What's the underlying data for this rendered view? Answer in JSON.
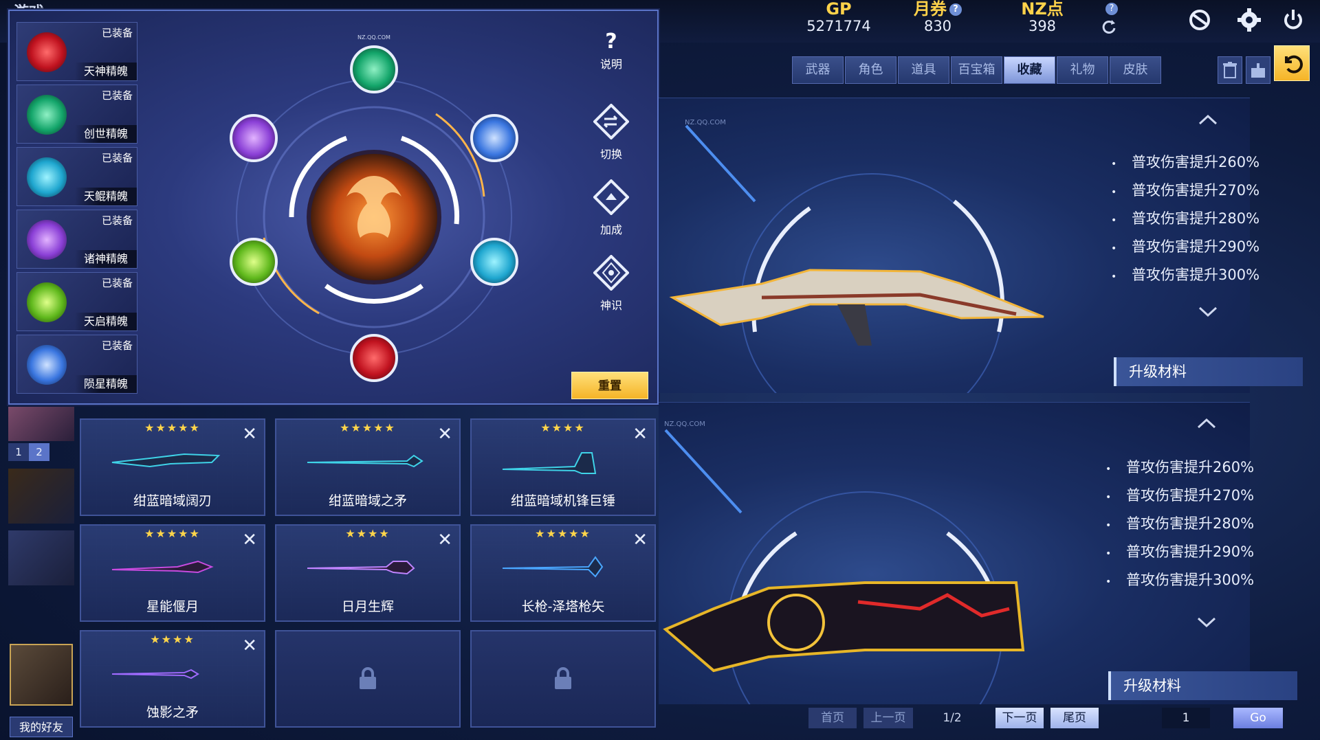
{
  "topbar": {
    "brand": "游戏",
    "gp": {
      "label": "GP",
      "value": "5271774"
    },
    "monthly": {
      "label": "月券",
      "value": "830"
    },
    "nz": {
      "label": "NZ点",
      "value": "398"
    }
  },
  "souls": [
    {
      "status": "已装备",
      "name": "天神精魄",
      "color": "#e0232f"
    },
    {
      "status": "已装备",
      "name": "创世精魄",
      "color": "#1fbf7f"
    },
    {
      "status": "已装备",
      "name": "天鲲精魄",
      "color": "#2fc3e6"
    },
    {
      "status": "已装备",
      "name": "诸神精魄",
      "color": "#9a4ee0"
    },
    {
      "status": "已装备",
      "name": "天启精魄",
      "color": "#7fd22a"
    },
    {
      "status": "已装备",
      "name": "陨星精魄",
      "color": "#3d7fe8"
    }
  ],
  "dialog": {
    "help_label": "说明",
    "switch_label": "切换",
    "bonus_label": "加成",
    "divine_label": "神识",
    "reset_label": "重置",
    "watermark": "NZ.QQ.COM"
  },
  "side_strip": {
    "page1": "1",
    "page2": "2",
    "friends_label": "我的好友"
  },
  "weapons": [
    {
      "stars": "★★★★★",
      "name": "绀蓝暗域阔刃",
      "accent": "#3fd3e8"
    },
    {
      "stars": "★★★★★",
      "name": "绀蓝暗域之矛",
      "accent": "#3fd3e8"
    },
    {
      "stars": "★★★★",
      "name": "绀蓝暗域机锋巨锤",
      "accent": "#3fd3e8"
    },
    {
      "stars": "★★★★★",
      "name": "星能偃月",
      "accent": "#c84be0"
    },
    {
      "stars": "★★★★",
      "name": "日月生辉",
      "accent": "#c084ff"
    },
    {
      "stars": "★★★★★",
      "name": "长枪-泽塔枪矢",
      "accent": "#4aa6ff"
    },
    {
      "stars": "★★★★",
      "name": "蚀影之矛",
      "accent": "#a06bff"
    }
  ],
  "tabs": [
    "武器",
    "角色",
    "道具",
    "百宝箱",
    "收藏",
    "礼物",
    "皮肤"
  ],
  "active_tab": "收藏",
  "showcase": [
    {
      "watermark": "NZ.QQ.COM",
      "stats": [
        "普攻伤害提升260%",
        "普攻伤害提升270%",
        "普攻伤害提升280%",
        "普攻伤害提升290%",
        "普攻伤害提升300%"
      ],
      "material_label": "升级材料"
    },
    {
      "watermark": "NZ.QQ.COM",
      "stats": [
        "普攻伤害提升260%",
        "普攻伤害提升270%",
        "普攻伤害提升280%",
        "普攻伤害提升290%",
        "普攻伤害提升300%"
      ],
      "material_label": "升级材料"
    }
  ],
  "pager": {
    "first": "首页",
    "prev": "上一页",
    "page": "1/2",
    "next": "下一页",
    "last": "尾页",
    "input": "1",
    "go": "Go"
  }
}
